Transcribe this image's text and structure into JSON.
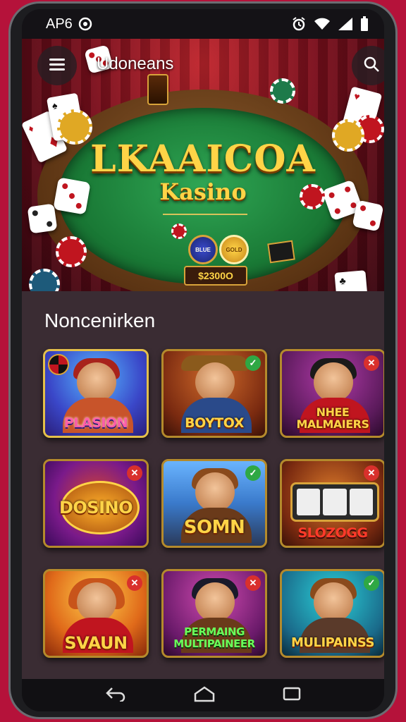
{
  "status_bar": {
    "carrier": "AP6",
    "carrier_icon": "settings-icon",
    "icons": [
      "alarm-icon",
      "wifi-icon",
      "signal-icon",
      "battery-icon"
    ]
  },
  "header": {
    "title": "Udoneans",
    "menu_icon": "menu-icon",
    "search_icon": "search-icon"
  },
  "hero": {
    "title": "LKAAICOA",
    "subtitle": "Kasino",
    "score": "$2300O",
    "coin_left": "BLUE",
    "coin_right": "GOLD"
  },
  "section": {
    "title": "Noncenirken"
  },
  "games": [
    {
      "label": "PLASION",
      "badge": ""
    },
    {
      "label": "BOYTOX",
      "badge": "✓"
    },
    {
      "label": "NHEE MALMAIERS",
      "badge": "✕"
    },
    {
      "label": "DOSINO",
      "badge": "✕"
    },
    {
      "label": "SOMN",
      "badge": "✓"
    },
    {
      "label": "SLOZOGG",
      "badge": "✕"
    },
    {
      "label": "SVAUN",
      "badge": "✕"
    },
    {
      "label": "PERMAING MULTIPAINEER",
      "badge": "✕"
    },
    {
      "label": "MULIPAINSS",
      "badge": "✓"
    }
  ],
  "colors": {
    "accent": "#ffd447",
    "background": "#b5123a",
    "felt": "#1a7a36",
    "badge_red": "#d9302c",
    "badge_green": "#2fa844"
  },
  "nav": {
    "icons": [
      "back-icon",
      "home-icon",
      "recents-icon"
    ]
  }
}
